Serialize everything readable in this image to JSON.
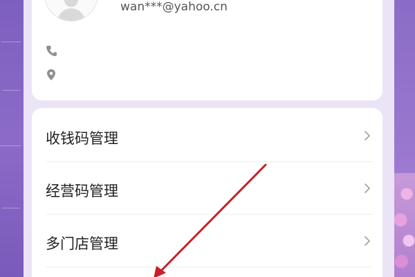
{
  "profile": {
    "email": "wan***@yahoo.cn"
  },
  "icons": {
    "phone": "phone-icon",
    "location": "location-pin-icon",
    "chevron": "chevron-right-icon"
  },
  "menu": {
    "items": [
      {
        "label": "收钱码管理"
      },
      {
        "label": "经营码管理"
      },
      {
        "label": "多门店管理"
      }
    ]
  },
  "colors": {
    "background": "#9a7bd4",
    "card": "#ffffff",
    "page": "#ebe4f7",
    "annotation_arrow": "#c8202a"
  }
}
